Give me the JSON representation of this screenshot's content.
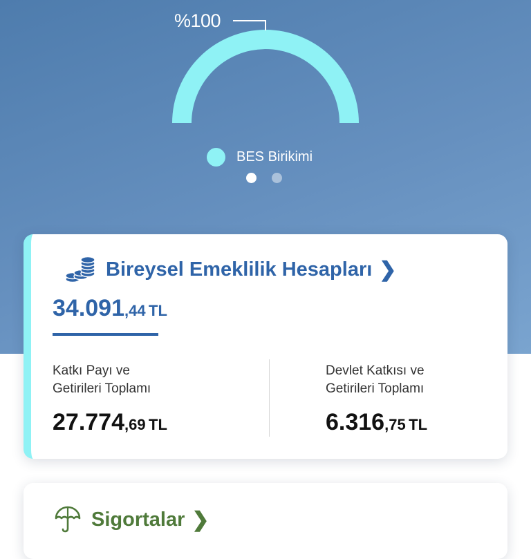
{
  "gauge": {
    "percent_label": "%100",
    "fill_fraction": 1.0,
    "color": "#8ff2f5",
    "legend_label": "BES Birikimi"
  },
  "pager": {
    "pages": 2,
    "active_index": 0
  },
  "bes_card": {
    "icon": "coins-stack-icon",
    "title": "Bireysel Emeklilik Hesapları",
    "total": {
      "integer": "34.091",
      "decimal": ",44",
      "currency": "TL"
    },
    "left": {
      "label_line1": "Katkı Payı ve",
      "label_line2": "Getirileri Toplamı",
      "integer": "27.774",
      "decimal": ",69",
      "currency": "TL"
    },
    "right": {
      "label_line1": "Devlet Katkısı ve",
      "label_line2": "Getirileri Toplamı",
      "integer": "6.316",
      "decimal": ",75",
      "currency": "TL"
    },
    "accent_color": "#2f64a8"
  },
  "insurance_card": {
    "icon": "umbrella-icon",
    "title": "Sigortalar",
    "accent_color": "#4f7a3a"
  }
}
